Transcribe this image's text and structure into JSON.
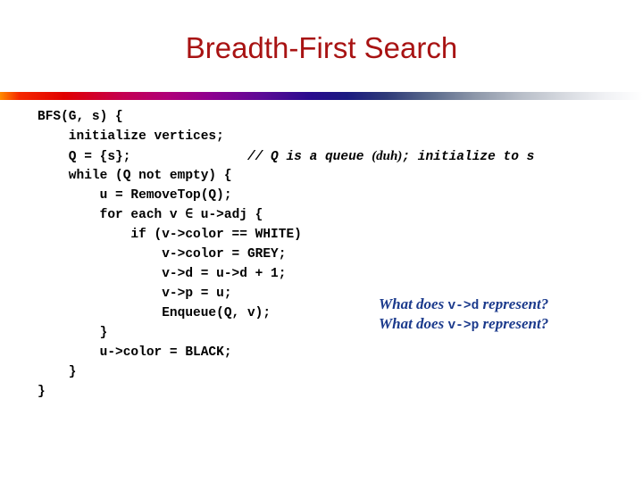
{
  "slide": {
    "title": "Breadth-First Search",
    "title_color": "#a81313",
    "background_color": "#ffffff",
    "rule": {
      "name": "title-gradient-rule",
      "colors": [
        "#ff8c00",
        "#e00000",
        "#b00078",
        "#8c0090",
        "#2a0a8e",
        "#1a1a80",
        "#5a6a8c",
        "#b8bec8",
        "#ffffff"
      ]
    }
  },
  "code": {
    "language": "pseudocode",
    "lines": [
      {
        "indent": 0,
        "text": "BFS(G, s) {"
      },
      {
        "indent": 4,
        "text": "initialize vertices;"
      },
      {
        "indent": 4,
        "text": "Q = {s};",
        "pad_to": 23,
        "comment_prefix": "// Q is a queue ",
        "comment_emph": "(duh)",
        "comment_suffix": "; initialize to s"
      },
      {
        "indent": 4,
        "text": "while (Q not empty) {"
      },
      {
        "indent": 8,
        "text": "u = RemoveTop(Q);"
      },
      {
        "indent": 8,
        "text": "for each v ∈ u->adj {"
      },
      {
        "indent": 12,
        "text": "if (v->color == WHITE)"
      },
      {
        "indent": 16,
        "text": "v->color = GREY;"
      },
      {
        "indent": 16,
        "text": "v->d = u->d + 1;"
      },
      {
        "indent": 16,
        "text": "v->p = u;"
      },
      {
        "indent": 16,
        "text": "Enqueue(Q, v);"
      },
      {
        "indent": 8,
        "text": "}"
      },
      {
        "indent": 8,
        "text": "u->color = BLACK;"
      },
      {
        "indent": 4,
        "text": "}"
      },
      {
        "indent": 0,
        "text": "}"
      }
    ]
  },
  "annotations": {
    "color": "#1b3a8c",
    "items": [
      {
        "prefix": "What does ",
        "code": "v->d",
        "suffix": " represent?"
      },
      {
        "prefix": "What does ",
        "code": "v->p",
        "suffix": " represent?"
      }
    ]
  }
}
